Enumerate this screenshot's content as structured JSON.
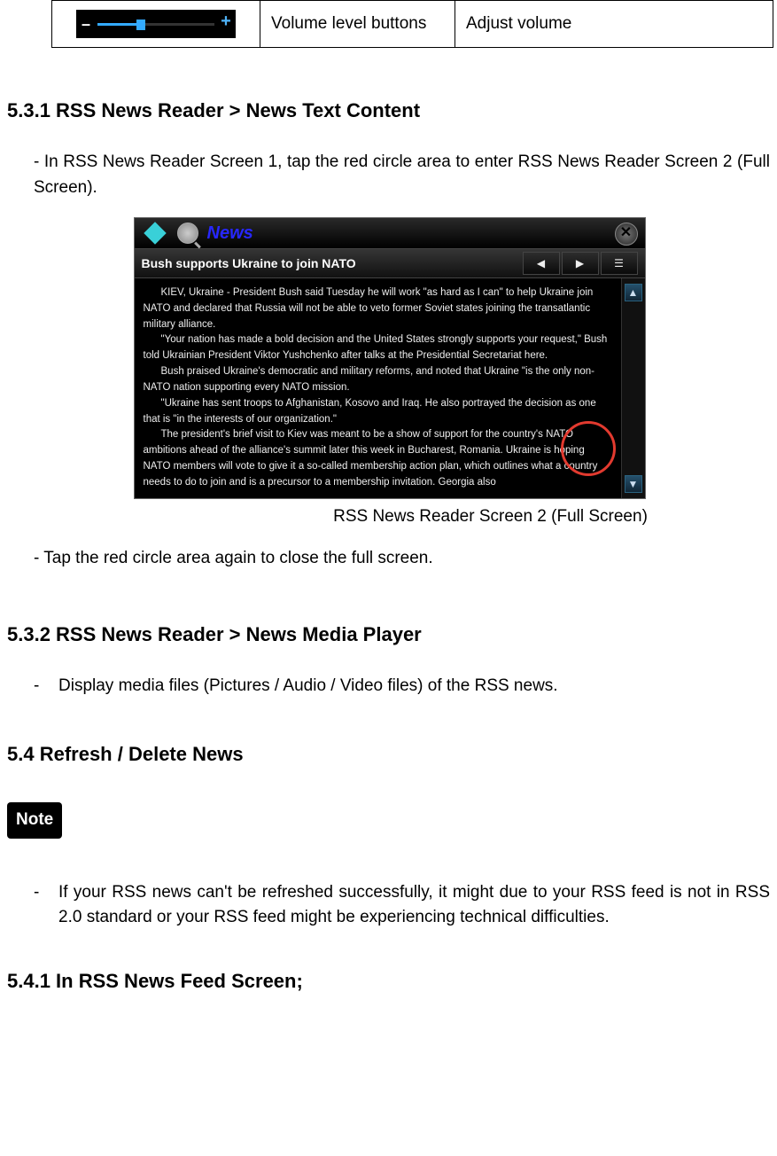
{
  "table": {
    "col2": "Volume level buttons",
    "col3": "Adjust volume"
  },
  "h_531": "5.3.1 RSS News Reader > News Text Content",
  "p_531a": "- In RSS News Reader Screen 1, tap the red circle area to enter RSS News Reader Screen 2 (Full Screen).",
  "screenshot": {
    "title_word": "News",
    "headline": "Bush supports Ukraine to join NATO",
    "paragraphs": [
      "KIEV, Ukraine - President Bush said Tuesday he will work \"as hard as I can\" to help Ukraine join NATO and declared that Russia will not be able to veto former Soviet states joining the transatlantic military alliance.",
      "\"Your nation has made a bold decision and the United States strongly supports your request,\" Bush told Ukrainian President Viktor Yushchenko after talks at the Presidential Secretariat here.",
      "Bush praised Ukraine's democratic and military reforms, and noted that Ukraine \"is the only non-NATO nation supporting every NATO mission.",
      "\"Ukraine has sent troops to Afghanistan, Kosovo and Iraq. He also portrayed the decision as one that is \"in the interests of our organization.\"",
      "The president's brief visit to Kiev was meant to be a show of support for the country's NATO ambitions ahead of the alliance's summit later this week in Bucharest, Romania. Ukraine is hoping NATO members will vote to give it a so-called membership action plan, which outlines what a country needs to do to join and is a precursor to a membership invitation. Georgia also"
    ]
  },
  "caption_531": "RSS News Reader Screen 2 (Full Screen)",
  "p_531b": "- Tap the red circle area again to close the full screen.",
  "h_532": "5.3.2 RSS News Reader > News Media Player",
  "p_532": "Display media files (Pictures / Audio / Video files) of the RSS news.",
  "h_54": "5.4 Refresh / Delete News",
  "note_label": "Note",
  "p_54": "If your RSS news can't be refreshed successfully, it might due to your RSS feed is not in RSS 2.0 standard or your RSS feed might be experiencing technical difficulties.",
  "h_541": "5.4.1 In RSS News Feed Screen;"
}
